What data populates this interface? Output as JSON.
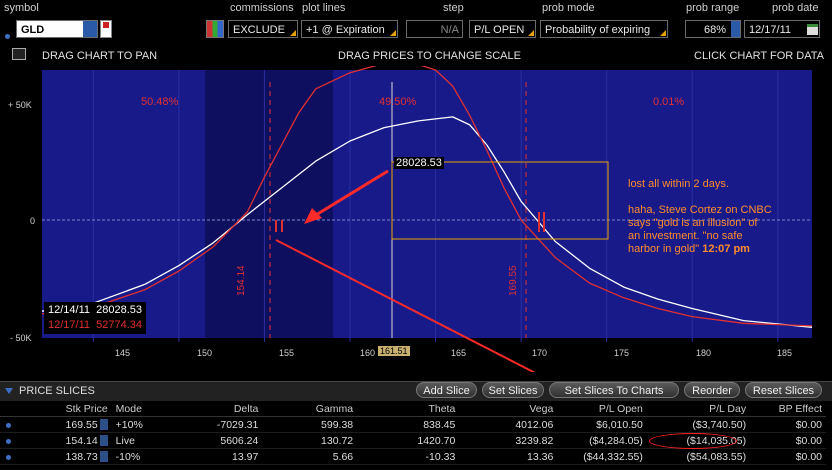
{
  "toolbar": {
    "symbol_label": "symbol",
    "symbol_value": "GLD",
    "commissions_label": "commissions",
    "commissions_value": "EXCLUDE",
    "plot_lines_label": "plot lines",
    "plot_lines_value": "+1 @ Expiration",
    "step_label": "step",
    "step_value": "N/A",
    "pl_value": "P/L OPEN",
    "prob_mode_label": "prob mode",
    "prob_mode_value": "Probability of expiring",
    "prob_range_label": "prob range",
    "prob_range_value": "68%",
    "prob_date_label": "prob date",
    "prob_date_value": "12/17/11"
  },
  "subbar": {
    "left": "DRAG CHART TO PAN",
    "center": "DRAG PRICES TO CHANGE SCALE",
    "right": "CLICK CHART FOR DATA"
  },
  "chart_data": {
    "type": "line",
    "x_range": [
      142,
      187
    ],
    "y_range": [
      -50000,
      50000
    ],
    "x_ticks": [
      "145",
      "150",
      "155",
      "160",
      "165",
      "170",
      "175",
      "180",
      "185"
    ],
    "y_ticks": [
      "+ 50K",
      "0",
      "- 50K"
    ],
    "region_probs": [
      "50.48%",
      "49.50%",
      "0.01%"
    ],
    "breakeven_labels": [
      "154.14",
      "169.55"
    ],
    "cursor_label": "161.51",
    "cursor_value_label": "28028.53",
    "legend": [
      {
        "date": "12/14/11",
        "value": "28028.53",
        "color": "#ffffff"
      },
      {
        "date": "12/17/11",
        "value": "52774.34",
        "color": "#e03030"
      }
    ],
    "series": [
      {
        "name": "12/14/11",
        "color": "#ffffff",
        "points": [
          [
            142,
            -40000
          ],
          [
            145,
            -37000
          ],
          [
            148,
            -30000
          ],
          [
            150,
            -23000
          ],
          [
            152,
            -14500
          ],
          [
            154,
            -4000
          ],
          [
            156,
            6000
          ],
          [
            158,
            16000
          ],
          [
            160,
            23500
          ],
          [
            162,
            28500
          ],
          [
            164,
            31000
          ],
          [
            166,
            32500
          ],
          [
            167,
            29500
          ],
          [
            168,
            22000
          ],
          [
            169,
            12000
          ],
          [
            170,
            1000
          ],
          [
            172,
            -14000
          ],
          [
            174,
            -24000
          ],
          [
            176,
            -31000
          ],
          [
            178,
            -35500
          ],
          [
            180,
            -39000
          ],
          [
            183,
            -43500
          ],
          [
            187,
            -46000
          ]
        ]
      },
      {
        "name": "12/17/11",
        "color": "#e03030",
        "points": [
          [
            142,
            -41000
          ],
          [
            145,
            -38500
          ],
          [
            148,
            -32000
          ],
          [
            150,
            -25000
          ],
          [
            152,
            -16000
          ],
          [
            154,
            -3000
          ],
          [
            155,
            10000
          ],
          [
            156,
            22000
          ],
          [
            157,
            34000
          ],
          [
            158,
            43000
          ],
          [
            160,
            49000
          ],
          [
            162,
            52500
          ],
          [
            164,
            52000
          ],
          [
            165,
            50000
          ],
          [
            166,
            44000
          ],
          [
            167,
            33000
          ],
          [
            168,
            20000
          ],
          [
            169,
            6000
          ],
          [
            170,
            -6000
          ],
          [
            172,
            -20000
          ],
          [
            174,
            -29500
          ],
          [
            176,
            -35000
          ],
          [
            178,
            -39000
          ],
          [
            180,
            -42000
          ],
          [
            183,
            -44500
          ],
          [
            187,
            -45500
          ]
        ]
      }
    ]
  },
  "annotation": {
    "line1": "lost all within 2 days.",
    "line2": "haha, Steve Cortez on CNBC",
    "line3": "says \"gold is an illusion\" of",
    "line4": "an investment. \"no safe",
    "line5": "harbor in gold\"",
    "time": "12:07 pm"
  },
  "price_slices": {
    "title": "PRICE SLICES",
    "buttons": [
      "Add Slice",
      "Set Slices",
      "Set Slices To Charts",
      "Reorder",
      "Reset Slices"
    ],
    "columns": [
      "Stk Price",
      "Mode",
      "Delta",
      "Gamma",
      "Theta",
      "Vega",
      "P/L Open",
      "P/L Day",
      "BP Effect"
    ],
    "rows": [
      [
        "169.55",
        "+10%",
        "-7029.31",
        "599.38",
        "838.45",
        "4012.06",
        "$6,010.50",
        "($3,740.50)",
        "$0.00"
      ],
      [
        "154.14",
        "Live",
        "5606.24",
        "130.72",
        "1420.70",
        "3239.82",
        "($4,284.05)",
        "($14,035.05)",
        "$0.00"
      ],
      [
        "138.73",
        "-10%",
        "13.97",
        "5.66",
        "-10.33",
        "13.36",
        "($44,332.55)",
        "($54,083.55)",
        "$0.00"
      ]
    ]
  }
}
